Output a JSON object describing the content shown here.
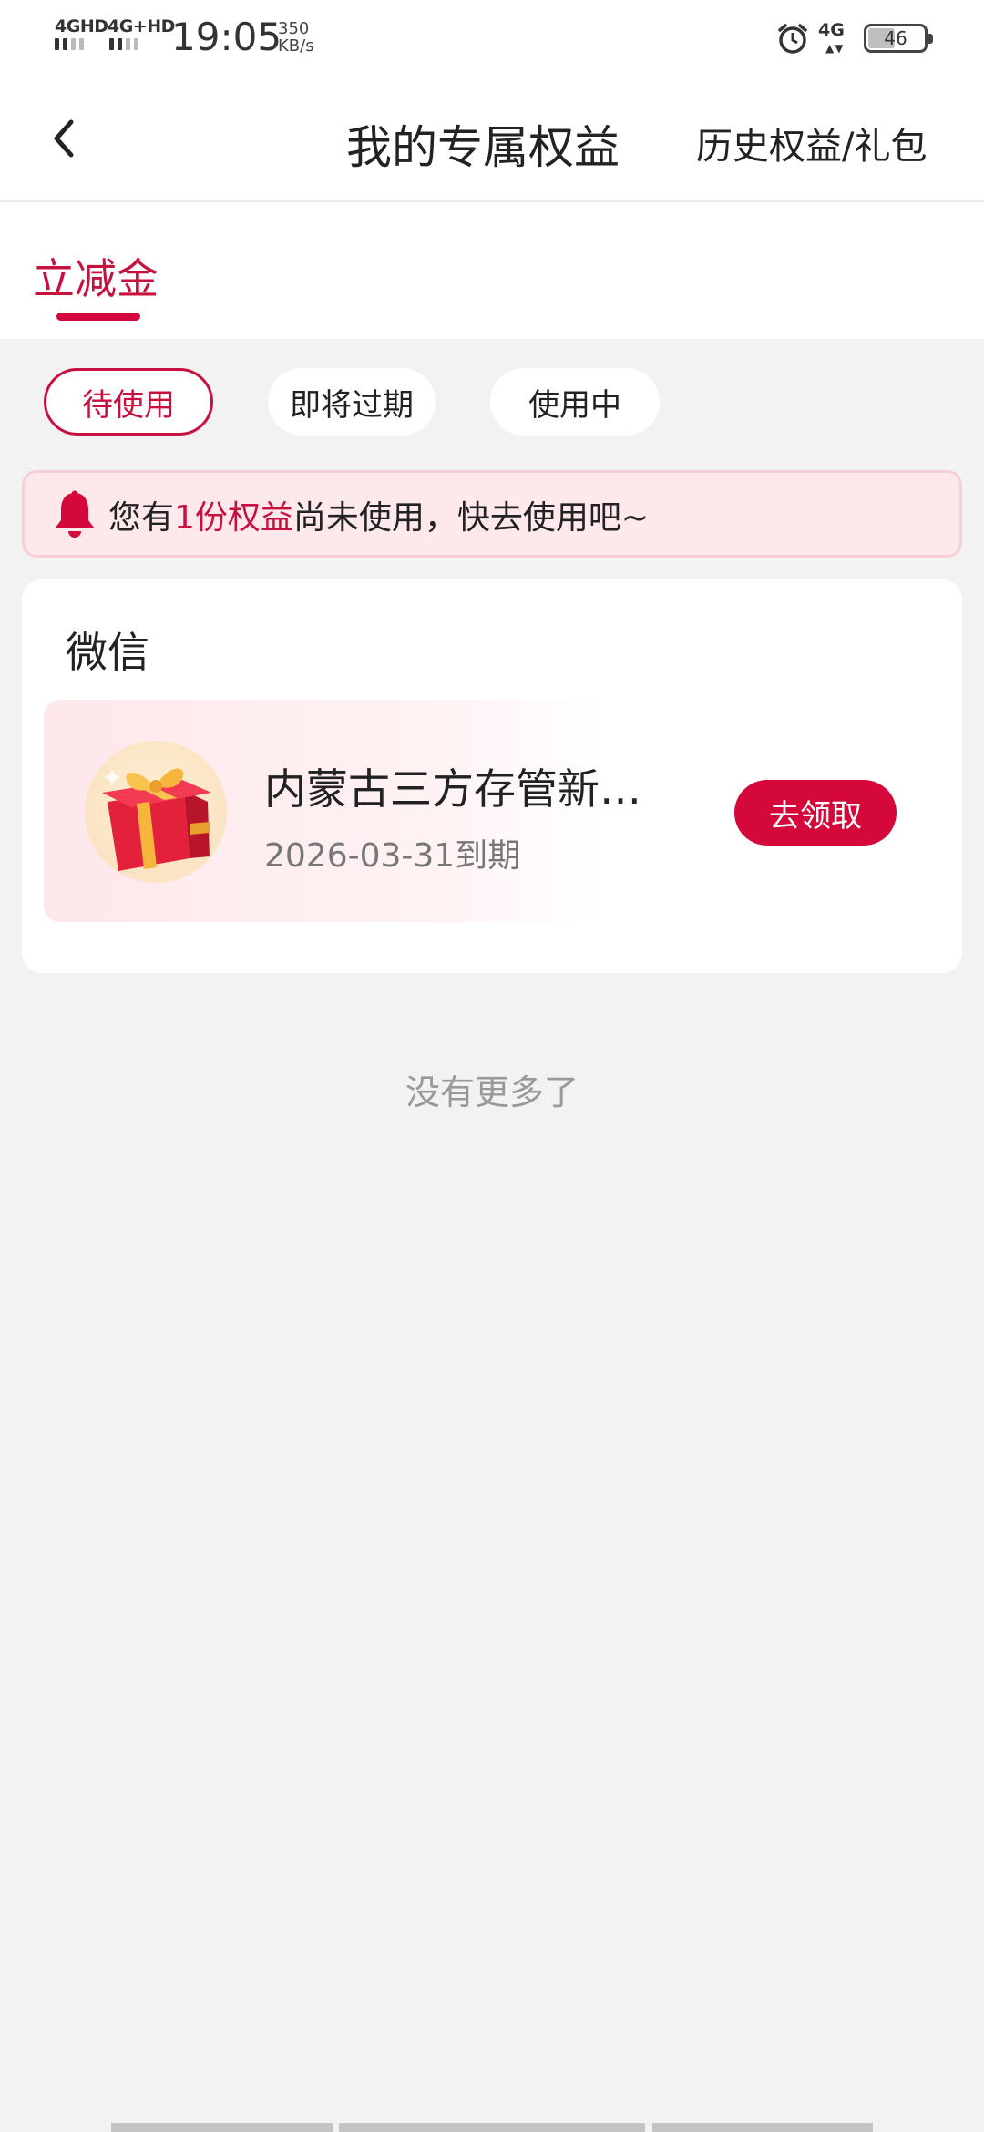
{
  "status_bar": {
    "sim1": "4GHD",
    "sim2": "4G+HD",
    "time": "19:05",
    "speed_value": "350",
    "speed_unit": "KB/s",
    "network": "4G",
    "network_arrows": "▲▼",
    "battery": "46",
    "battery_level": 0.46
  },
  "header": {
    "title": "我的专属权益",
    "history_link": "历史权益/礼包"
  },
  "tabs": {
    "active": "立减金"
  },
  "filters": [
    {
      "label": "待使用",
      "active": true
    },
    {
      "label": "即将过期",
      "active": false
    },
    {
      "label": "使用中",
      "active": false
    }
  ],
  "notice": {
    "prefix": "您有",
    "highlight": "1份权益",
    "suffix": "尚未使用，快去使用吧~"
  },
  "card": {
    "title": "微信",
    "benefit": {
      "name": "内蒙古三方存管新…",
      "expiry": "2026-03-31到期",
      "button": "去领取"
    }
  },
  "footer": {
    "no_more": "没有更多了"
  },
  "colors": {
    "accent": "#d4083a",
    "notice_bg": "#fde9ec",
    "page_bg": "#f2f2f2"
  }
}
